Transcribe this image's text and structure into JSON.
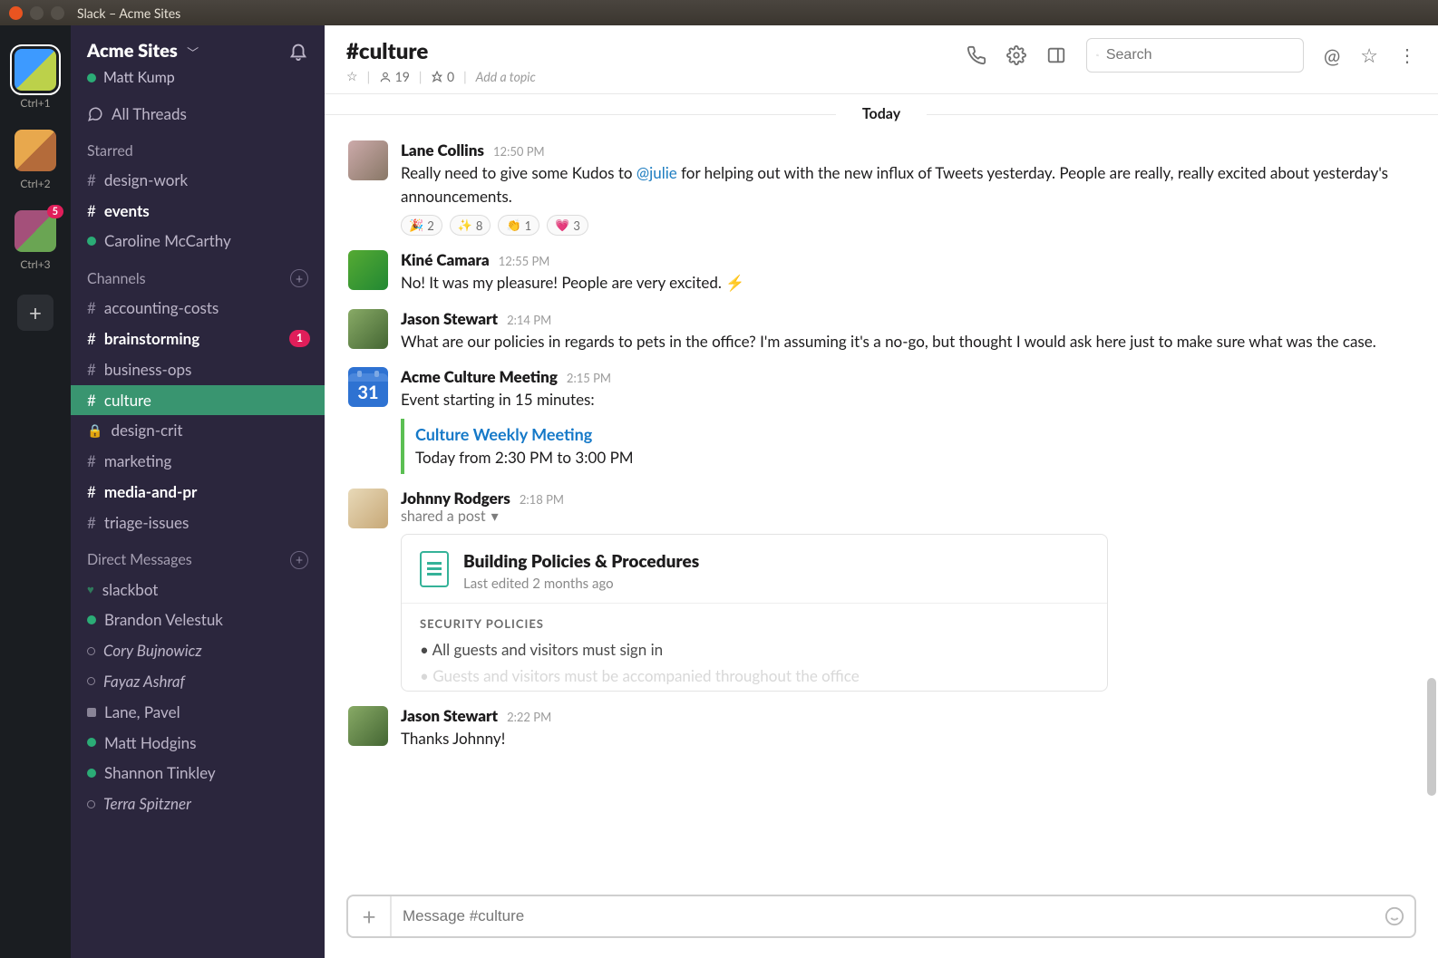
{
  "window": {
    "title": "Slack – Acme Sites"
  },
  "rail": {
    "workspaces": [
      {
        "shortcut": "Ctrl+1"
      },
      {
        "shortcut": "Ctrl+2"
      },
      {
        "shortcut": "Ctrl+3",
        "badge": "5"
      }
    ]
  },
  "sidebar": {
    "workspace_name": "Acme Sites",
    "user_name": "Matt Kump",
    "threads_label": "All Threads",
    "starred_label": "Starred",
    "starred": [
      {
        "type": "channel",
        "name": "design-work"
      },
      {
        "type": "channel",
        "name": "events",
        "unread": true
      },
      {
        "type": "dm",
        "name": "Caroline McCarthy",
        "presence": "active"
      }
    ],
    "channels_label": "Channels",
    "channels": [
      {
        "name": "accounting-costs"
      },
      {
        "name": "brainstorming",
        "unread": true,
        "badge": "1"
      },
      {
        "name": "business-ops"
      },
      {
        "name": "culture",
        "active": true
      },
      {
        "name": "design-crit",
        "private": true
      },
      {
        "name": "marketing"
      },
      {
        "name": "media-and-pr",
        "unread": true
      },
      {
        "name": "triage-issues"
      }
    ],
    "dms_label": "Direct Messages",
    "dms": [
      {
        "name": "slackbot",
        "presence": "heart"
      },
      {
        "name": "Brandon Velestuk",
        "presence": "active"
      },
      {
        "name": "Cory Bujnowicz",
        "presence": "away",
        "italic": true
      },
      {
        "name": "Fayaz Ashraf",
        "presence": "away",
        "italic": true
      },
      {
        "name": "Lane, Pavel",
        "presence": "group"
      },
      {
        "name": "Matt Hodgins",
        "presence": "active"
      },
      {
        "name": "Shannon Tinkley",
        "presence": "active"
      },
      {
        "name": "Terra Spitzner",
        "presence": "away",
        "italic": true
      }
    ]
  },
  "header": {
    "channel_name": "#culture",
    "members": "19",
    "pins": "0",
    "topic_placeholder": "Add a topic",
    "search_placeholder": "Search"
  },
  "divider_label": "Today",
  "messages": [
    {
      "author": "Lane Collins",
      "time": "12:50 PM",
      "text_before": "Really need to give some Kudos to ",
      "mention": "@julie",
      "text_after": " for helping out with the new influx of Tweets yesterday. People are really, really excited about yesterday's announcements.",
      "reactions": [
        {
          "emoji": "🎉",
          "count": "2"
        },
        {
          "emoji": "✨",
          "count": "8"
        },
        {
          "emoji": "👏",
          "count": "1"
        },
        {
          "emoji": "💗",
          "count": "3"
        }
      ]
    },
    {
      "author": "Kiné Camara",
      "time": "12:55 PM",
      "text": "No! It was my pleasure! People are very excited.  ⚡"
    },
    {
      "author": "Jason Stewart",
      "time": "2:14 PM",
      "text": "What are our policies in regards to pets in the office? I'm assuming it's a no-go, but thought I would ask here just to make sure what was the case."
    },
    {
      "author": "Acme Culture Meeting",
      "time": "2:15 PM",
      "cal_day": "31",
      "text": "Event starting in 15 minutes:",
      "event_title": "Culture Weekly Meeting",
      "event_time": "Today from 2:30 PM to 3:00 PM"
    },
    {
      "author": "Johnny Rodgers",
      "time": "2:18 PM",
      "subline": "shared a post",
      "post_title": "Building Policies & Procedures",
      "post_sub": "Last edited 2 months ago",
      "post_section": "SECURITY POLICIES",
      "post_bullet": "• All guests and visitors must sign in",
      "post_faded": "• Guests and visitors must be accompanied throughout the office"
    },
    {
      "author": "Jason Stewart",
      "time": "2:22 PM",
      "text": "Thanks Johnny!"
    }
  ],
  "composer": {
    "placeholder": "Message #culture"
  }
}
